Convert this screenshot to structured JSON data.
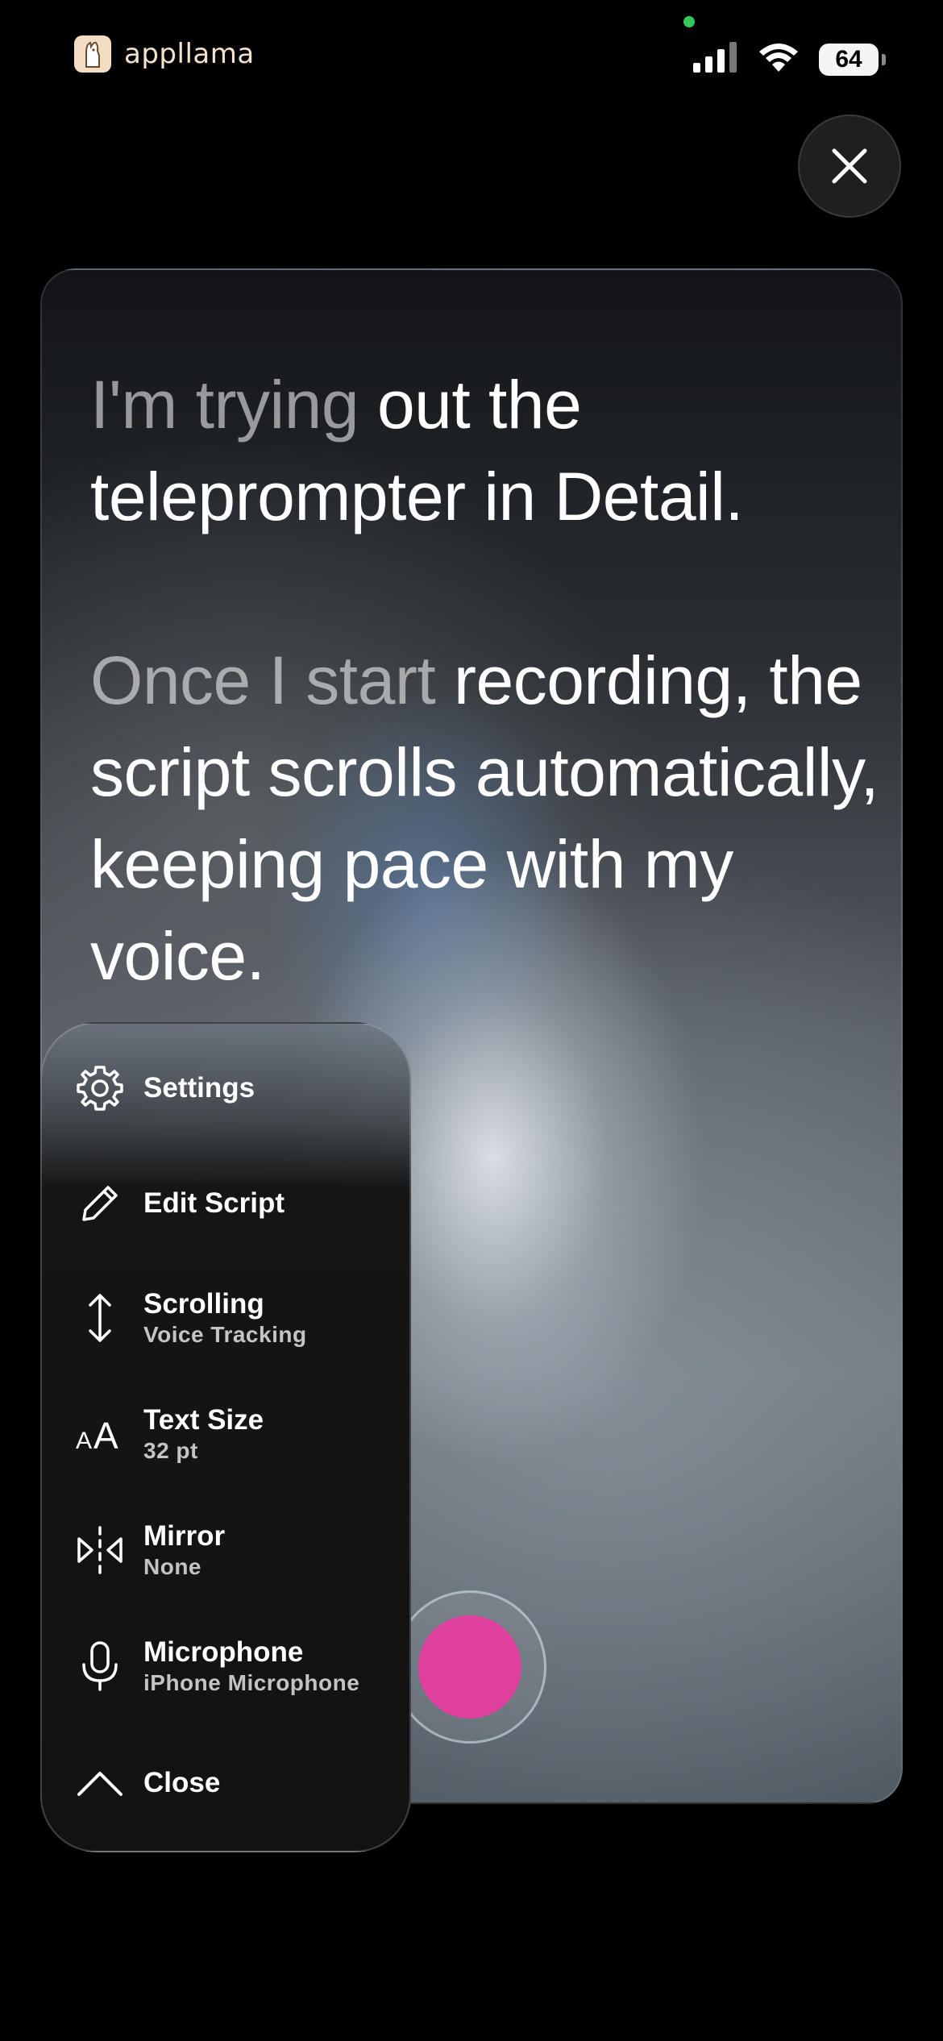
{
  "status_bar": {
    "app_name": "appllama",
    "battery": "64"
  },
  "script": {
    "paragraphs": [
      {
        "read": "I'm trying ",
        "unread": "out the teleprompter in Detail."
      },
      {
        "read": "Once I start ",
        "unread": "recording, the script scrolls automatically, keeping pace with my voice."
      }
    ]
  },
  "menu": {
    "items": [
      {
        "label": "Settings",
        "sub": "",
        "icon": "gear-icon"
      },
      {
        "label": "Edit Script",
        "sub": "",
        "icon": "pencil-icon"
      },
      {
        "label": "Scrolling",
        "sub": "Voice Tracking",
        "icon": "vertical-arrows-icon"
      },
      {
        "label": "Text Size",
        "sub": "32 pt",
        "icon": "text-size-icon"
      },
      {
        "label": "Mirror",
        "sub": "None",
        "icon": "mirror-icon"
      },
      {
        "label": "Microphone",
        "sub": "iPhone Microphone",
        "icon": "microphone-icon"
      },
      {
        "label": "Close",
        "sub": "",
        "icon": "chevron-up-icon"
      }
    ]
  },
  "colors": {
    "record": "#e0409e",
    "background": "#000000"
  }
}
